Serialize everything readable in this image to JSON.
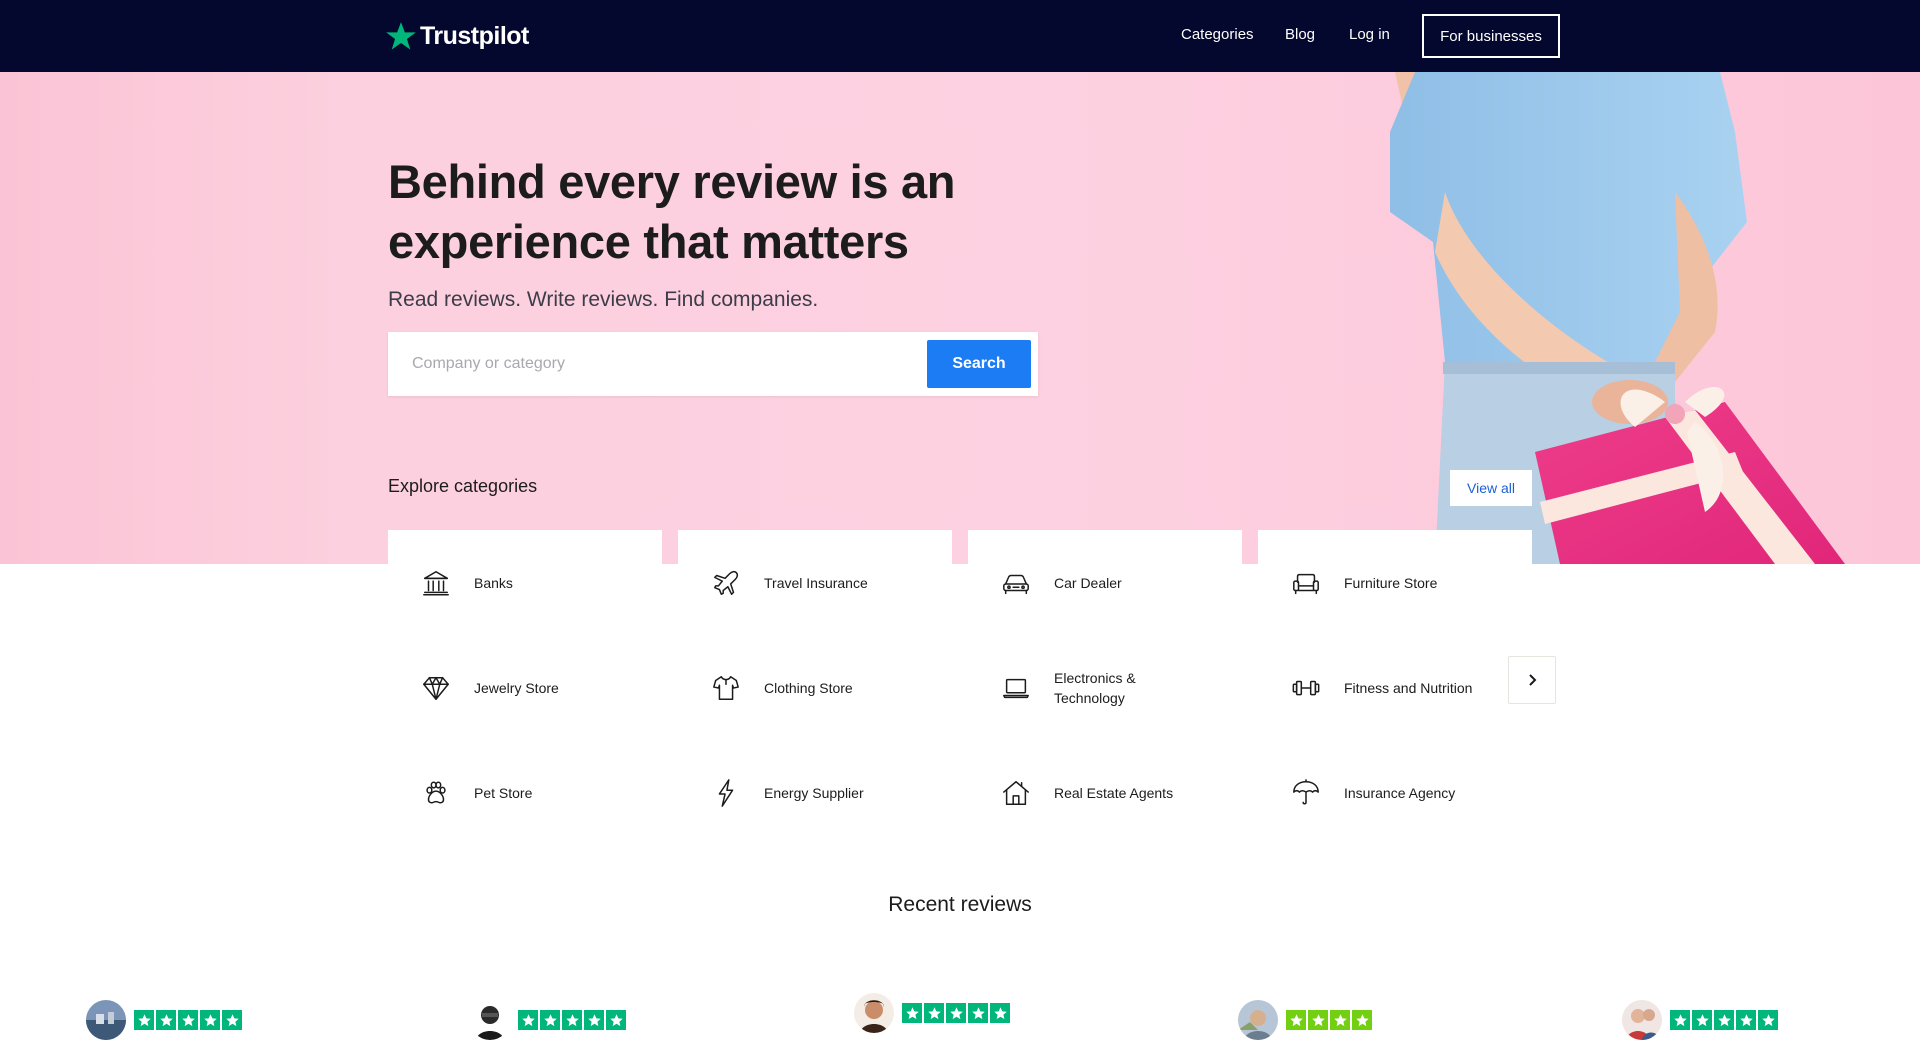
{
  "header": {
    "logo_text": "Trustpilot",
    "nav": {
      "categories": "Categories",
      "blog": "Blog",
      "login": "Log in",
      "for_businesses": "For businesses"
    }
  },
  "hero": {
    "title_line1": "Behind every review is an",
    "title_line2": "experience that matters",
    "subtitle": "Read reviews. Write reviews. Find companies.",
    "search": {
      "placeholder": "Company or category",
      "value": "",
      "button_label": "Search"
    },
    "explore_title": "Explore categories",
    "view_all_label": "View all"
  },
  "categories": [
    {
      "label": "Banks",
      "icon": "bank-icon"
    },
    {
      "label": "Travel Insurance",
      "icon": "airplane-icon"
    },
    {
      "label": "Car Dealer",
      "icon": "car-icon"
    },
    {
      "label": "Furniture Store",
      "icon": "sofa-icon"
    },
    {
      "label": "Jewelry Store",
      "icon": "diamond-icon"
    },
    {
      "label": "Clothing Store",
      "icon": "shirt-icon"
    },
    {
      "label": "Electronics & Technology",
      "icon": "laptop-icon"
    },
    {
      "label": "Fitness and Nutrition",
      "icon": "dumbbell-icon"
    },
    {
      "label": "Pet Store",
      "icon": "paw-icon"
    },
    {
      "label": "Energy Supplier",
      "icon": "lightning-icon"
    },
    {
      "label": "Real Estate Agents",
      "icon": "house-icon"
    },
    {
      "label": "Insurance Agency",
      "icon": "umbrella-icon"
    }
  ],
  "recent_reviews": {
    "title": "Recent reviews",
    "items": [
      {
        "rating": 5,
        "star_color": "#00b67a"
      },
      {
        "rating": 5,
        "star_color": "#00b67a"
      },
      {
        "rating": 5,
        "star_color": "#00b67a"
      },
      {
        "rating": 4,
        "star_color": "#73cf11"
      },
      {
        "rating": 5,
        "star_color": "#00b67a"
      }
    ]
  },
  "colors": {
    "nav_bg": "#04072e",
    "hero_bg": "#fcd0de",
    "search_button": "#1c7cf4",
    "link": "#1c5fd6",
    "star_green": "#00b67a",
    "star_lightgreen": "#73cf11",
    "logo_star": "#00b67a"
  }
}
